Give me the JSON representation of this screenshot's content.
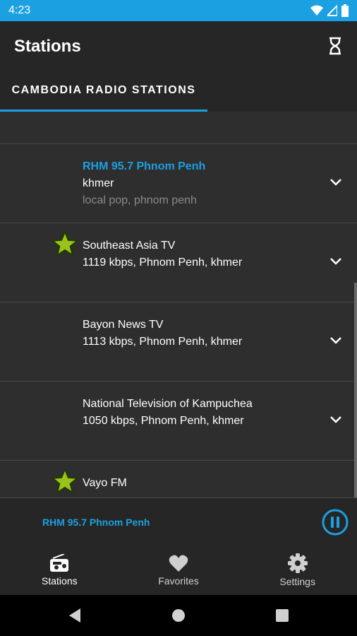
{
  "status_bar": {
    "time": "4:23"
  },
  "app_bar": {
    "title": "Stations",
    "tab_label": "CAMBODIA RADIO STATIONS"
  },
  "stations": [
    {
      "name": "RHM 95.7 Phnom Penh",
      "details": "khmer",
      "tags": "local pop, phnom penh",
      "favorite": false,
      "playing": true
    },
    {
      "name": "Southeast Asia TV",
      "details": "1119 kbps, Phnom Penh, khmer",
      "favorite": true,
      "playing": false
    },
    {
      "name": "Bayon News TV",
      "details": "1113 kbps, Phnom Penh, khmer",
      "favorite": false,
      "playing": false
    },
    {
      "name": "National Television of Kampuchea",
      "details": "1050 kbps, Phnom Penh, khmer",
      "favorite": false,
      "playing": false
    },
    {
      "name": "Vayo FM",
      "favorite": true,
      "playing": false
    }
  ],
  "player": {
    "now_playing": "RHM 95.7 Phnom Penh"
  },
  "bottom_nav": {
    "items": [
      {
        "label": "Stations",
        "icon": "radio-icon",
        "active": true
      },
      {
        "label": "Favorites",
        "icon": "heart-icon",
        "active": false
      },
      {
        "label": "Settings",
        "icon": "gear-icon",
        "active": false
      }
    ]
  },
  "colors": {
    "accent": "#1ba0e2",
    "star": "#9ac21a",
    "background": "#2e2e2e"
  }
}
